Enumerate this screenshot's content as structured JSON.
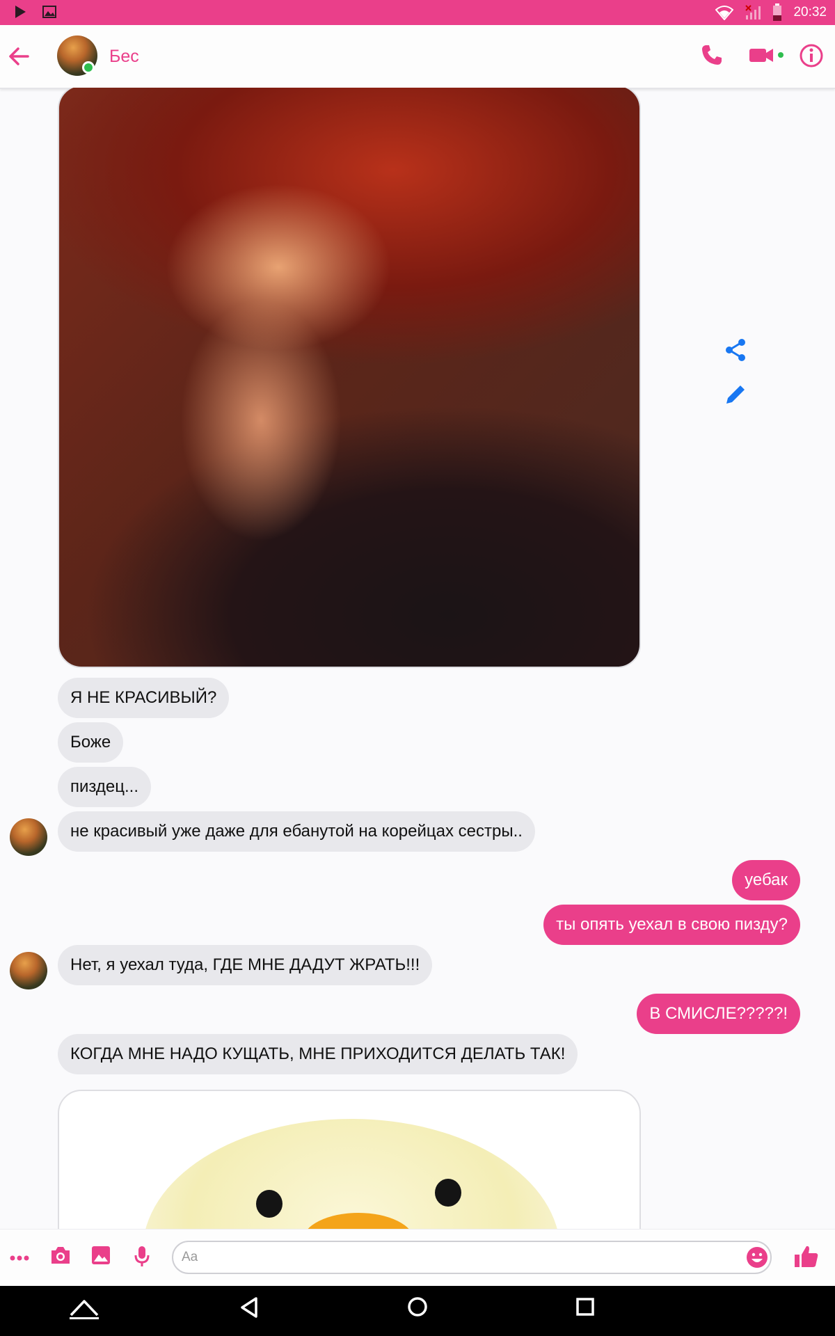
{
  "status_bar": {
    "time": "20:32",
    "icons": [
      "play-icon",
      "image-notification-icon",
      "wifi-icon",
      "signal-off-icon",
      "battery-icon"
    ],
    "color": "#ea3f8a"
  },
  "header": {
    "contact_name": "Бес",
    "online": true,
    "actions": [
      "back-arrow-icon",
      "phone-icon",
      "video-icon",
      "info-icon"
    ]
  },
  "messages": [
    {
      "type": "image",
      "from": "contact",
      "description_icon": "photo"
    },
    {
      "type": "text",
      "from": "contact",
      "text": "Я НЕ КРАСИВЫЙ?"
    },
    {
      "type": "text",
      "from": "contact",
      "text": "Боже"
    },
    {
      "type": "text",
      "from": "contact",
      "text": "пиздец..."
    },
    {
      "type": "text",
      "from": "contact",
      "text": "не красивый уже даже для ебанутой на корейцах сестры.."
    },
    {
      "type": "text",
      "from": "me",
      "text": "уебак"
    },
    {
      "type": "text",
      "from": "me",
      "text": "ты опять уехал в свою пизду?"
    },
    {
      "type": "text",
      "from": "contact",
      "text": "Нет, я уехал туда, ГДЕ МНЕ ДАДУТ ЖРАТЬ!!!"
    },
    {
      "type": "text",
      "from": "me",
      "text": "В СМИСЛЕ?????!"
    },
    {
      "type": "text",
      "from": "contact",
      "text": "КОГДА МНЕ НАДО КУЩАТЬ, МНЕ ПРИХОДИТСЯ ДЕЛАТЬ ТАК!"
    },
    {
      "type": "image",
      "from": "contact"
    }
  ],
  "composer": {
    "placeholder": "Aa",
    "icons": [
      "more-icon",
      "camera-icon",
      "gallery-icon",
      "mic-icon",
      "emoji-icon",
      "like-icon"
    ],
    "accent": "#ea3f8a"
  },
  "nav_bar": {
    "icons": [
      "home-up-icon",
      "back-icon",
      "home-icon",
      "recents-icon"
    ]
  }
}
